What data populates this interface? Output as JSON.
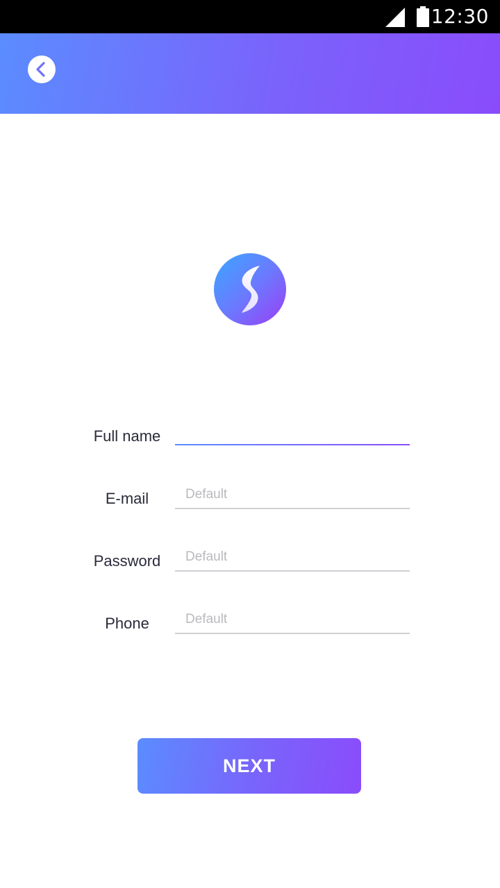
{
  "status_bar": {
    "time": "12:30",
    "icons": [
      "signal-icon",
      "battery-icon"
    ]
  },
  "header": {
    "back_icon": "chevron-left-icon"
  },
  "logo": {
    "icon": "lightning-s-logo"
  },
  "form": {
    "fields": [
      {
        "label": "Full name",
        "value": "",
        "placeholder": ""
      },
      {
        "label": "E-mail",
        "value": "",
        "placeholder": "Default"
      },
      {
        "label": "Password",
        "value": "",
        "placeholder": "Default"
      },
      {
        "label": "Phone",
        "value": "",
        "placeholder": "Default"
      }
    ]
  },
  "actions": {
    "next_label": "NEXT"
  },
  "colors": {
    "gradient_start": "#5b8cff",
    "gradient_end": "#8a4cfb",
    "status_bar": "#000000",
    "underline_inactive": "#cfcfd4",
    "label_text": "#2a2a3a",
    "placeholder_text": "#b9b9bf"
  }
}
